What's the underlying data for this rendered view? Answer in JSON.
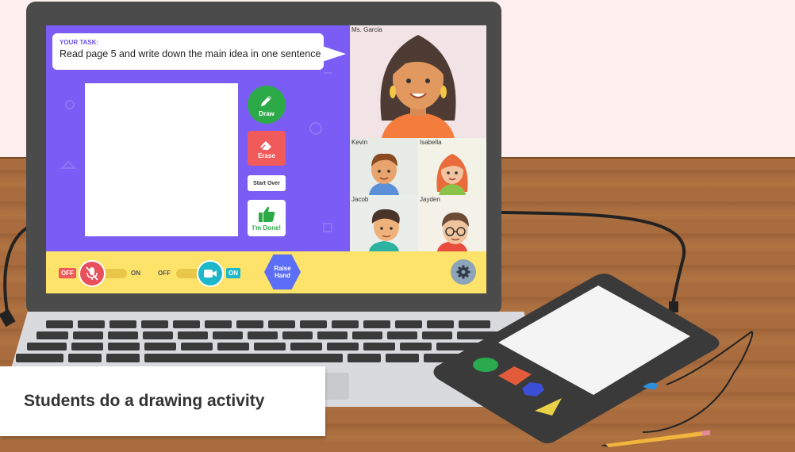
{
  "scene": {
    "caption": "Students do a drawing activity"
  },
  "task": {
    "label": "YOUR TASK:",
    "text": "Read page 5 and write down the main idea in one sentence"
  },
  "tools": {
    "draw_label": "Draw",
    "erase_label": "Erase",
    "start_over_label": "Start Over",
    "done_label": "I'm Done!"
  },
  "participants": {
    "teacher": "Ms. Garcia",
    "students": [
      "Kevin",
      "Isabella",
      "Jacob",
      "Jayden"
    ]
  },
  "toolbar": {
    "mic": {
      "off_label": "OFF",
      "on_label": "ON",
      "state": "off"
    },
    "camera": {
      "off_label": "OFF",
      "on_label": "ON",
      "state": "on"
    },
    "raise_hand_line1": "Raise",
    "raise_hand_line2": "Hand",
    "settings_icon": "gear-icon"
  },
  "colors": {
    "app_bg": "#7b5cf5",
    "toolbar_bg": "#fde36a",
    "draw": "#2daa48",
    "erase": "#f05a5a",
    "camera_on": "#1cb7c9",
    "raise_hand": "#5b6ef5"
  }
}
